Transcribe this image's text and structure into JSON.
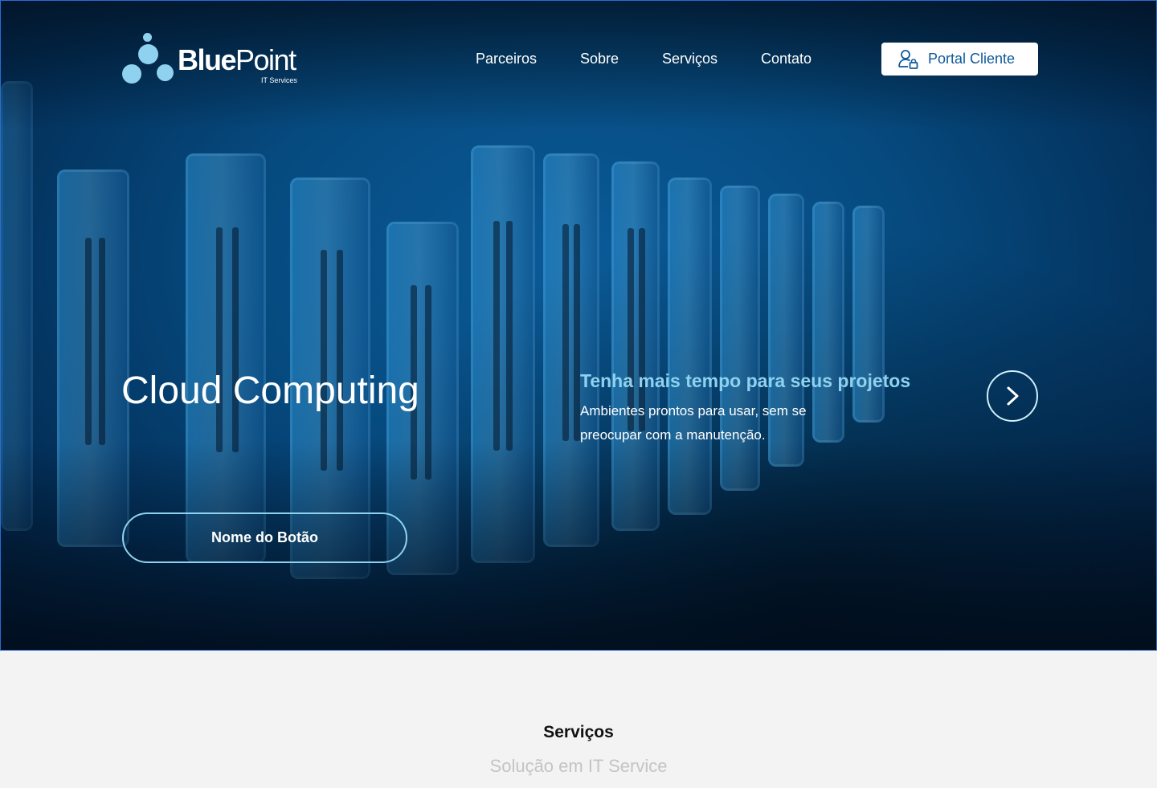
{
  "brand": {
    "name_bold": "Blue",
    "name_light": "Point",
    "tagline": "IT Services"
  },
  "nav": {
    "items": [
      {
        "label": "Parceiros"
      },
      {
        "label": "Sobre"
      },
      {
        "label": "Serviços"
      },
      {
        "label": "Contato"
      }
    ],
    "portal_label": "Portal Cliente",
    "portal_icon": "user-lock-icon"
  },
  "hero": {
    "title": "Cloud Computing",
    "subtitle": "Tenha mais tempo para seus projetos",
    "text": "Ambientes prontos para usar, sem se preocupar com a manutenção.",
    "cta_label": "Nome do Botão",
    "next_icon": "chevron-right-icon"
  },
  "services": {
    "title": "Serviços",
    "subtitle": "Solução em IT Service"
  },
  "colors": {
    "accent": "#8fd2ef",
    "brand_blue": "#0e5a9a",
    "hero_bg": "#064b80",
    "section_bg": "#f3f3f3"
  }
}
